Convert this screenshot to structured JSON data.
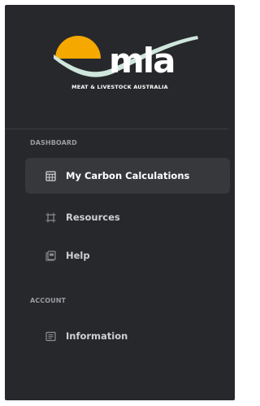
{
  "brand": {
    "word": "mla",
    "tagline": "MEAT & LIVESTOCK AUSTRALIA",
    "colors": {
      "sun": "#f5a800",
      "ribbon": "#cfe6dc",
      "text": "#ffffff"
    }
  },
  "sections": {
    "dashboard": {
      "label": "DASHBOARD",
      "items": [
        {
          "label": "My Carbon Calculations",
          "icon": "calculator-icon",
          "active": true
        },
        {
          "label": "Resources",
          "icon": "resources-icon",
          "active": false
        },
        {
          "label": "Help",
          "icon": "help-book-icon",
          "active": false
        }
      ]
    },
    "account": {
      "label": "ACCOUNT",
      "items": [
        {
          "label": "Information",
          "icon": "info-card-icon",
          "active": false
        }
      ]
    }
  },
  "colors": {
    "sidebar_bg": "#27282b",
    "active_bg": "#37383c",
    "section_label": "#9a9ca1",
    "item_text": "#cfd0d3"
  }
}
